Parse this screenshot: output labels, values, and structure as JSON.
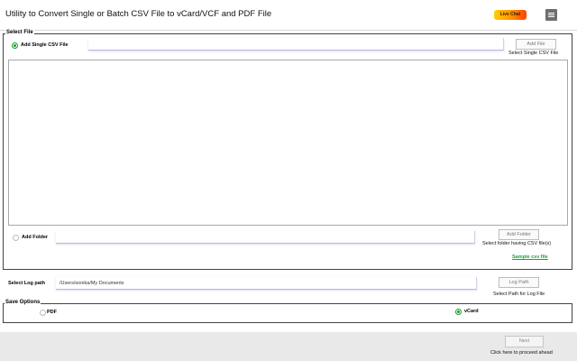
{
  "header": {
    "title": "Utility to Convert Single or Batch CSV File to vCard/VCF and PDF File",
    "live_chat": "Live Chat",
    "menu_icon": "hamburger-menu-icon"
  },
  "select_file": {
    "legend": "Select File",
    "single": {
      "radio_label": "Add Single CSV File",
      "selected": true,
      "input_value": "",
      "button_label": "Add File",
      "hint": "Select Single CSV File"
    },
    "folder": {
      "radio_label": "Add Folder",
      "selected": false,
      "input_value": "",
      "button_label": "Add Folder",
      "hint": "Select folder having CSV file(s)"
    },
    "sample_link": "Sample csv file"
  },
  "log": {
    "label": "Select Log path",
    "path": "/Users/sonika/My Documents",
    "button_label": "Log Path",
    "hint": "Select Path for Log File"
  },
  "save_options": {
    "legend": "Save Options",
    "options": [
      {
        "label": "PDF",
        "selected": false
      },
      {
        "label": "vCard",
        "selected": true
      }
    ]
  },
  "footer": {
    "next_label": "Next",
    "next_hint": "Click here to proceed ahead"
  },
  "colors": {
    "accent_green": "#1a9a2a",
    "live_chat_gradient_start": "#ffd000",
    "live_chat_gradient_end": "#ff3d00"
  }
}
